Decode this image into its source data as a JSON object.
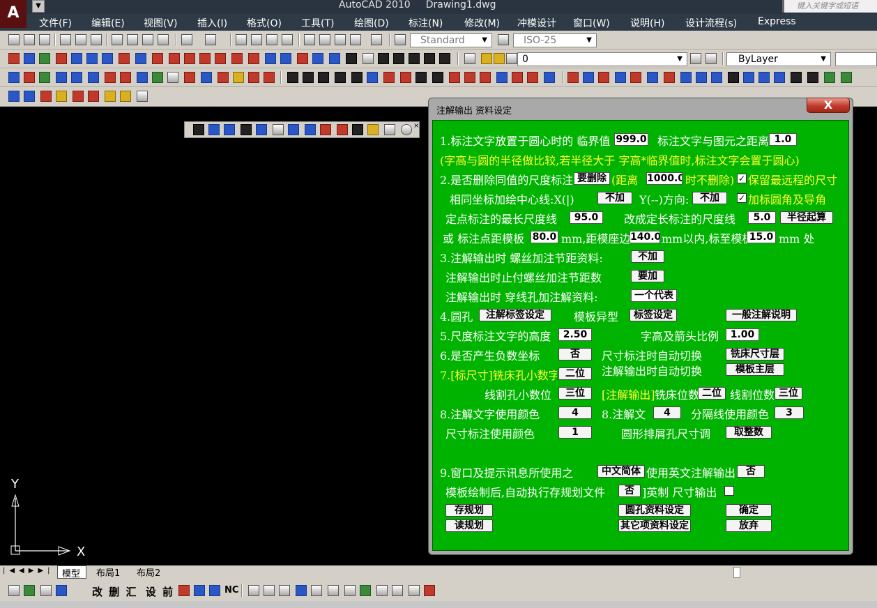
{
  "app": {
    "title": "AutoCAD 2010",
    "file": "Drawing1.dwg",
    "search_placeholder": "键入关键字或短语"
  },
  "menu": [
    "文件(F)",
    "编辑(E)",
    "视图(V)",
    "插入(I)",
    "格式(O)",
    "工具(T)",
    "绘图(D)",
    "标注(N)",
    "修改(M)",
    "冲模设计",
    "窗口(W)",
    "说明(H)",
    "设计流程(s)",
    "Express"
  ],
  "toolbar": {
    "text_style": "Standard",
    "dim_style": "ISO-25",
    "layer": "0",
    "color": "ByLayer"
  },
  "ucs": {
    "x": "X",
    "y": "Y"
  },
  "layout_tabs": [
    "模型",
    "布局1",
    "布局2"
  ],
  "bottom_tools": [
    "改",
    "删",
    "汇",
    "设",
    "前"
  ],
  "bottom_tools_nc": "NC",
  "dialog": {
    "title": "注解输出 资料设定",
    "close": "X",
    "r1_label": "1.标注文字放置于圆心时的 临界值",
    "r1_val": "999.0",
    "r1_label2": "标注文字与图元之距离",
    "r1_val2": "1.0",
    "r2_note": "(字高与圆的半径做比较,若半径大于 字高*临界值时,标注文字会置于圆心)",
    "r3_label": "2.是否删除同值的尺度标注",
    "r3_btn": "要删除",
    "r3_label2": "(距离",
    "r3_val": "1000.0",
    "r3_label3": "时不删除)",
    "r3_check": "保留最远程的尺寸",
    "r4_label": "相同坐标加绘中心线:X(|)",
    "r4_btn1": "不加",
    "r4_label2": "Y(--)方向:",
    "r4_btn2": "不加",
    "r4_check": "加标圆角及导角",
    "r5_label": "定点标注的最长尺度线",
    "r5_val": "95.0",
    "r5_label2": "改成定长标注的尺度线",
    "r5_val2": "5.0",
    "r5_btn": "半径起算",
    "r6_label": "或 标注点距模板",
    "r6_val1": "80.0",
    "r6_label2": "mm,距模座边",
    "r6_val2": "140.0",
    "r6_label3": "mm以内,标至模板",
    "r6_val3": "15.0",
    "r6_label4": "mm 处",
    "r7_label": "3.注解输出时 螺丝加注节距资料:",
    "r7_btn": "不加",
    "r8_label": "注解输出时止付螺丝加注节距数",
    "r8_btn": "要加",
    "r9_label": "注解输出时 穿线孔加注解资料:",
    "r9_btn": "一个代表",
    "r10_label": "4.圆孔",
    "r10_btn1": "注解标签设定",
    "r10_label2": "模板异型",
    "r10_btn2": "标签设定",
    "r10_btn3": "一般注解说明",
    "r11_label": "5.尺度标注文字的高度",
    "r11_val": "2.50",
    "r11_label2": "字高及箭头比例",
    "r11_val2": "1.00",
    "r12_label": "6.是否产生负数坐标",
    "r12_btn": "否",
    "r12_label2": "尺寸标注时自动切换",
    "r12_btn2": "铣床尺寸层",
    "r13_label": "7.[标尺寸]铣床孔小数字",
    "r13_btn": "二位",
    "r13_label2": "注解输出时自动切换",
    "r13_btn2": "模板主层",
    "r14_label": "线割孔小数位",
    "r14_btn": "三位",
    "r14_label2": "[注解输出]",
    "r14_label3": "铣床位数",
    "r14_btn2": "二位",
    "r14_label4": "线割位数",
    "r14_btn3": "三位",
    "r15_label": "8.注解文字使用颜色",
    "r15_val": "4",
    "r15_label2": "8.注解文",
    "r15_val2": "4",
    "r15_label3": "分隔线使用颜色",
    "r15_val3": "3",
    "r16_label": "尺寸标注使用颜色",
    "r16_val": "1",
    "r16_label2": "圆形排屑孔尺寸调",
    "r16_btn": "取整数",
    "r17_label": "9.窗口及提示讯息所使用之",
    "r17_btn": "中文简体",
    "r17_label2": "使用英文注解输出",
    "r17_btn2": "否",
    "r18_label": "模板绘制后,自动执行存规划文件",
    "r18_btn": "否",
    "r18_label2": "]英制 尺寸输出",
    "b_save": "存规划",
    "b_load": "读规划",
    "b_hole": "圆孔资料设定",
    "b_other": "其它项资料设定",
    "b_ok": "确定",
    "b_cancel": "放弃"
  }
}
